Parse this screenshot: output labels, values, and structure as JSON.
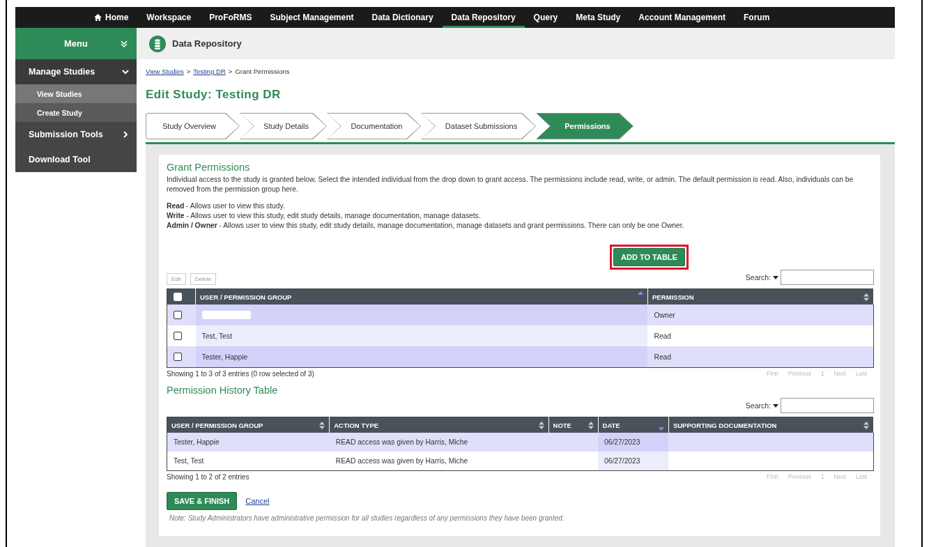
{
  "nav": [
    {
      "label": "Home",
      "kind": "home",
      "selected": false
    },
    {
      "label": "Workspace",
      "kind": "link",
      "selected": false
    },
    {
      "label": "ProFoRMS",
      "kind": "link",
      "selected": false
    },
    {
      "label": "Subject Management",
      "kind": "link",
      "selected": false
    },
    {
      "label": "Data Dictionary",
      "kind": "link",
      "selected": false
    },
    {
      "label": "Data Repository",
      "kind": "link",
      "selected": true
    },
    {
      "label": "Query",
      "kind": "link",
      "selected": false
    },
    {
      "label": "Meta Study",
      "kind": "link",
      "selected": false
    },
    {
      "label": "Account Management",
      "kind": "link",
      "selected": false
    },
    {
      "label": "Forum",
      "kind": "link",
      "selected": false
    }
  ],
  "sidebar": {
    "title": "Menu",
    "items": [
      {
        "label": "Manage Studies",
        "kind": "group",
        "expanded": true,
        "children": [
          {
            "label": "View Studies",
            "selected": true
          },
          {
            "label": "Create Study",
            "selected": false
          }
        ]
      },
      {
        "label": "Submission Tools",
        "kind": "group",
        "expanded": false
      },
      {
        "label": "Download Tool",
        "kind": "link"
      }
    ]
  },
  "header": {
    "title": "Data Repository"
  },
  "breadcrumb": [
    {
      "label": "View Studies",
      "kind": "link"
    },
    {
      "label": ">",
      "kind": "separator"
    },
    {
      "label": "Testing DR",
      "kind": "link"
    },
    {
      "label": ">",
      "kind": "separator"
    },
    {
      "label": "Grant Permissions",
      "kind": "current"
    }
  ],
  "page_title": "Edit Study: Testing DR",
  "steps": [
    {
      "label": "Study Overview",
      "selected": false
    },
    {
      "label": "Study Details",
      "selected": false
    },
    {
      "label": "Documentation",
      "selected": false
    },
    {
      "label": "Dataset Submissions",
      "selected": false
    },
    {
      "label": "Permissions",
      "selected": true
    }
  ],
  "grant": {
    "title": "Grant Permissions",
    "intro": "Individual access to the study is granted below. Select the intended individual from the drop down to grant access. The permissions include read, write, or admin. The default permission is read. Also, individuals can be removed from the permission group here.",
    "definitions": [
      "**Read** - Allows user to view this study.",
      "**Write** - Allows user to view this study, edit study details, manage documentation, manage datasets.",
      "**Admin / Owner** - Allows user to view this study, edit study details, manage documentation, manage datasets and grant permissions. There can only be one Owner."
    ],
    "add_button": "ADD TO TABLE",
    "add_highlighted": true,
    "actions": [
      {
        "label": "Edit",
        "disabled": true
      },
      {
        "label": "Delete",
        "disabled": true
      }
    ],
    "search_label": "Search:",
    "select_all_checked": false,
    "columns": [
      {
        "label": "USER / PERMISSION GROUP",
        "sorted": true,
        "descending": false
      },
      {
        "label": "PERMISSION",
        "sorted": false
      }
    ],
    "rows": [
      {
        "kind": "redacted",
        "permission": "Owner",
        "checked": false
      },
      {
        "kind": "user",
        "user": "Test, Test",
        "permission": "Read",
        "checked": false
      },
      {
        "kind": "user",
        "user": "Tester, Happie",
        "permission": "Read",
        "checked": false
      }
    ],
    "info": "Showing 1 to 3 of 3 entries (0 row selected of 3)",
    "pager": [
      "First",
      "Previous",
      "1",
      "Next",
      "Last"
    ]
  },
  "history": {
    "title": "Permission History Table",
    "search_label": "Search:",
    "columns": [
      {
        "label": "USER / PERMISSION GROUP",
        "sorted": false
      },
      {
        "label": "ACTION TYPE",
        "sorted": false
      },
      {
        "label": "NOTE",
        "sorted": false
      },
      {
        "label": "DATE",
        "sorted": true,
        "descending": true
      },
      {
        "label": "SUPPORTING DOCUMENTATION",
        "sorted": false
      }
    ],
    "rows": [
      [
        "Tester, Happie",
        "READ access was given by Harris, Miche",
        "",
        "06/27/2023",
        ""
      ],
      [
        "Test, Test",
        "READ access was given by Harris, Miche",
        "",
        "06/27/2023",
        ""
      ]
    ],
    "info": "Showing 1 to 2 of 2 entries",
    "pager": [
      "First",
      "Previous",
      "1",
      "Next",
      "Last"
    ]
  },
  "save_button": "SAVE & FINISH",
  "cancel_link": "Cancel",
  "note": "Note: Study Administrators have administrative permission for all studies regardless of any permissions they have been granted."
}
